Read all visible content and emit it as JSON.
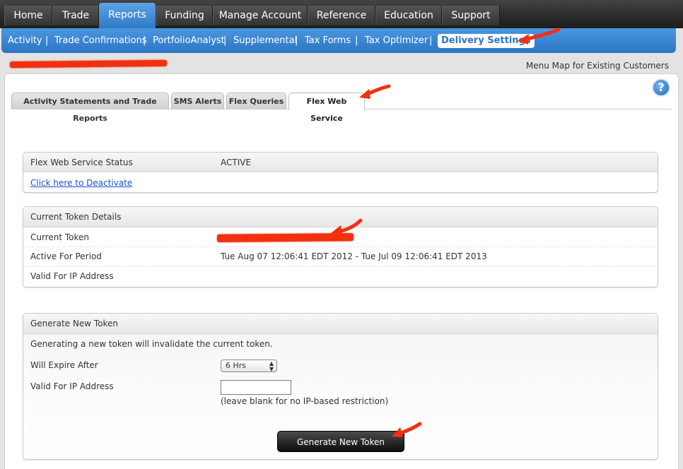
{
  "topnav": {
    "items": [
      {
        "label": "Home"
      },
      {
        "label": "Trade"
      },
      {
        "label": "Reports"
      },
      {
        "label": "Funding"
      },
      {
        "label": "Manage Account"
      },
      {
        "label": "Reference"
      },
      {
        "label": "Education"
      },
      {
        "label": "Support"
      }
    ],
    "active": "Reports"
  },
  "subnav": {
    "items": [
      {
        "label": "Activity"
      },
      {
        "label": "Trade Confirmations"
      },
      {
        "label": "PortfolioAnalyst"
      },
      {
        "label": "Supplemental"
      },
      {
        "label": "Tax Forms"
      },
      {
        "label": "Tax Optimizer"
      },
      {
        "label": "Delivery Settings"
      }
    ],
    "separator": "|",
    "active": "Delivery Settings"
  },
  "menu_map_label": "Menu Map for Existing Customers",
  "help_icon": {
    "icon": "help-icon",
    "glyph": "?"
  },
  "tabs": {
    "items": [
      {
        "label": "Activity Statements and Trade Reports"
      },
      {
        "label": "SMS Alerts"
      },
      {
        "label": "Flex Queries"
      },
      {
        "label": "Flex Web Service"
      }
    ],
    "active": "Flex Web Service"
  },
  "status_box": {
    "label": "Flex Web Service Status",
    "value": "ACTIVE",
    "deactivate_link": "Click here to Deactivate"
  },
  "token_box": {
    "title": "Current Token Details",
    "current_token_label": "Current Token",
    "active_period_label": "Active For Period",
    "active_period_value": "Tue Aug 07 12:06:41 EDT 2012 - Tue Jul 09 12:06:41 EDT 2013",
    "ip_label": "Valid For IP Address"
  },
  "generate_box": {
    "title": "Generate New Token",
    "warning": "Generating a new token will invalidate the current token.",
    "expire_label": "Will Expire After",
    "expire_value": "6 Hrs",
    "ip_label": "Valid For IP Address",
    "ip_value": "",
    "ip_hint": "(leave blank for no IP-based restriction)",
    "button_label": "Generate New Token"
  },
  "colors": {
    "nav_active": "#2f79c8",
    "subnav": "#3a86d4",
    "annotation_arrow": "#f2300f"
  }
}
